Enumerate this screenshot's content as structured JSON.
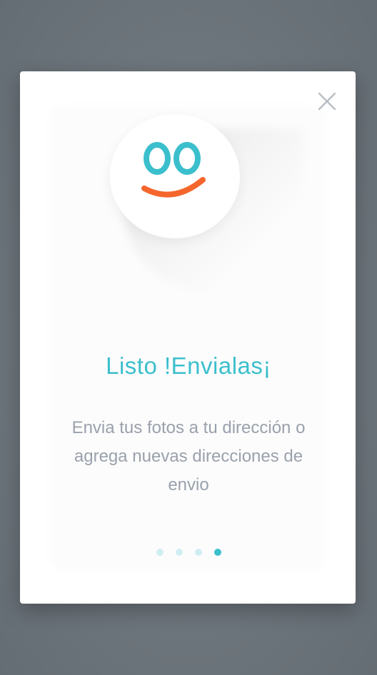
{
  "modal": {
    "title": "Listo !Envialas¡",
    "description": "Envia tus fotos a tu dirección o agrega nuevas direcciones de envio",
    "close_icon": "close-icon",
    "illustration_icon": "smiley-face-icon"
  },
  "pagination": {
    "total": 4,
    "current": 4
  },
  "colors": {
    "accent": "#3bbfcc",
    "smile": "#f5662d",
    "dot_inactive": "#cfeef2",
    "backdrop": "#6f777e"
  }
}
